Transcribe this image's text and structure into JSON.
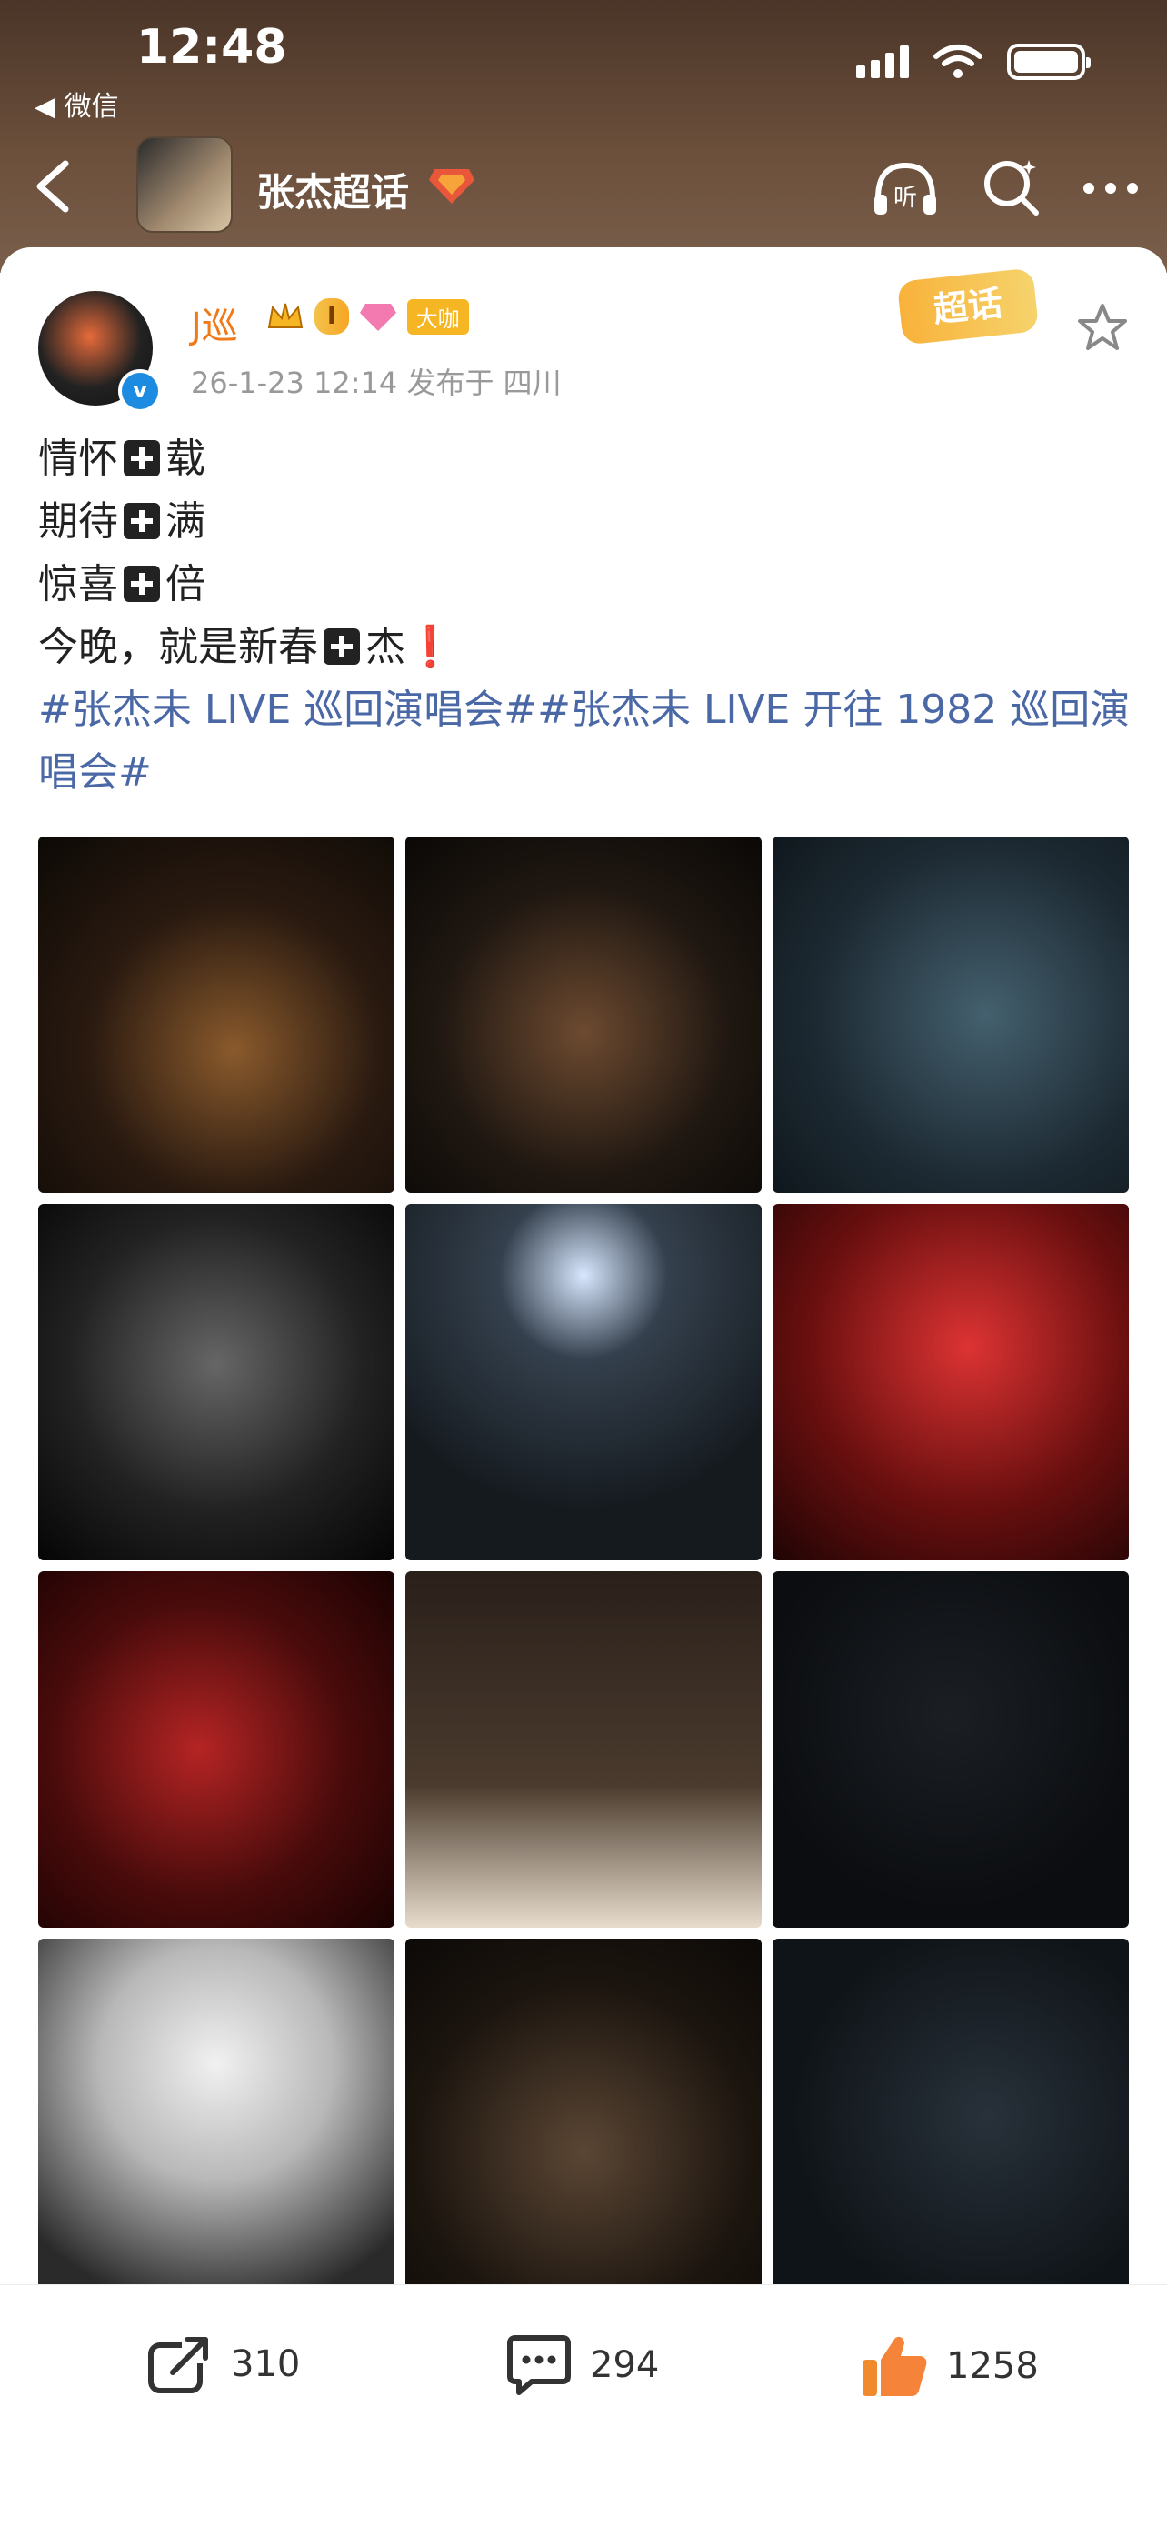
{
  "status_bar": {
    "time": "12:48",
    "back_app": "◀ 微信"
  },
  "nav": {
    "title": "张杰超话"
  },
  "post": {
    "author": "J巡",
    "level_badge": "I",
    "badge_dk": "大咖",
    "meta": "26-1-23 12:14   发布于 四川",
    "supertopic_badge": "超话",
    "lines": [
      {
        "pre": "情怀",
        "post": "载"
      },
      {
        "pre": "期待",
        "post": "满"
      },
      {
        "pre": "惊喜",
        "post": "倍"
      }
    ],
    "line4_pre": "今晚，就是新春",
    "line4_post": "杰",
    "exclaim": "❗",
    "tag_line1": "#张杰未 LIVE 巡回演唱会##张杰未 LIVE 开往 1982 巡回演",
    "tag_line2": "唱会#"
  },
  "actions": {
    "repost_count": "310",
    "comment_count": "294",
    "like_count": "1258"
  },
  "colors": {
    "accent_orange": "#f07a1a",
    "topic_blue": "#4a67a6",
    "header_brown": "#5e4536"
  }
}
